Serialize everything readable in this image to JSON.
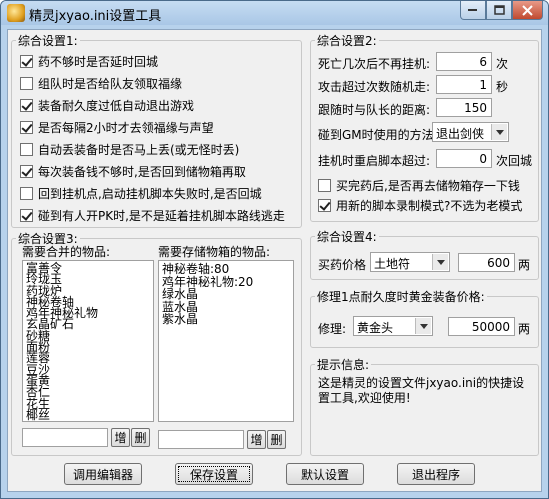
{
  "window": {
    "title": "精灵jxyao.ini设置工具"
  },
  "group1": {
    "legend": "综合设置1:",
    "options": [
      {
        "label": "药不够时是否延时回城",
        "checked": true
      },
      {
        "label": "组队时是否给队友领取福缘",
        "checked": false
      },
      {
        "label": "装备耐久度过低自动退出游戏",
        "checked": true
      },
      {
        "label": "是否每隔2小时才去领福缘与声望",
        "checked": true
      },
      {
        "label": "自动丢装备时是否马上丢(或无怪时丢)",
        "checked": false
      },
      {
        "label": "每次装备钱不够时,是否回到储物箱再取",
        "checked": true
      },
      {
        "label": "回到挂机点,启动挂机脚本失败时,是否回城",
        "checked": false
      },
      {
        "label": "碰到有人开PK时,是不是延着挂机脚本路线逃走",
        "checked": true
      }
    ]
  },
  "group2": {
    "legend": "综合设置2:",
    "death_times": {
      "label": "死亡几次后不再挂机:",
      "value": "6",
      "unit": "次"
    },
    "attack_time": {
      "label": "攻击超过次数随机走:",
      "value": "1",
      "unit": "秒"
    },
    "follow_dist": {
      "label": "跟随时与队长的距离:",
      "value": "150"
    },
    "gm_method": {
      "label": "碰到GM时使用的方法:",
      "value": "退出剑侠"
    },
    "restart": {
      "label": "挂机时重启脚本超过:",
      "value": "0",
      "unit": "次回城"
    },
    "opt_store": {
      "label": "买完药后,是否再去储物箱存一下钱",
      "checked": false
    },
    "opt_newmode": {
      "label": "用新的脚本录制模式?不选为老模式",
      "checked": true
    }
  },
  "group3": {
    "legend": "综合设置3:",
    "merge_label": "需要合并的物品:",
    "merge_items": [
      "富善令",
      "玲珑玉",
      "药珑炉",
      "神秘卷轴",
      "鸡年神秘礼物",
      "玄晶矿石",
      "砂糖",
      "面粉",
      "莲蓉",
      "豆沙",
      "蛋黄",
      "杏仁",
      "花生",
      "椰丝"
    ],
    "store_label": "需要存储物箱的物品:",
    "store_items": [
      "神秘卷轴:80",
      "鸡年神秘礼物:20",
      "绿水晶",
      "蓝水晶",
      "紫水晶"
    ],
    "add_label": "增",
    "del_label": "删"
  },
  "group4": {
    "legend": "综合设置4:",
    "buy_label": "买药价格",
    "buy_item": "土地符",
    "buy_price": "600",
    "unit": "两"
  },
  "group5": {
    "legend": "修理1点耐久度时黄金装备价格:",
    "repair_label": "修理:",
    "repair_item": "黄金头",
    "repair_price": "50000",
    "unit": "两"
  },
  "hint": {
    "legend": "提示信息:",
    "text": "这是精灵的设置文件jxyao.ini的快捷设置工具,欢迎使用!"
  },
  "buttons": {
    "editor": "调用编辑器",
    "save": "保存设置",
    "default": "默认设置",
    "exit": "退出程序"
  }
}
